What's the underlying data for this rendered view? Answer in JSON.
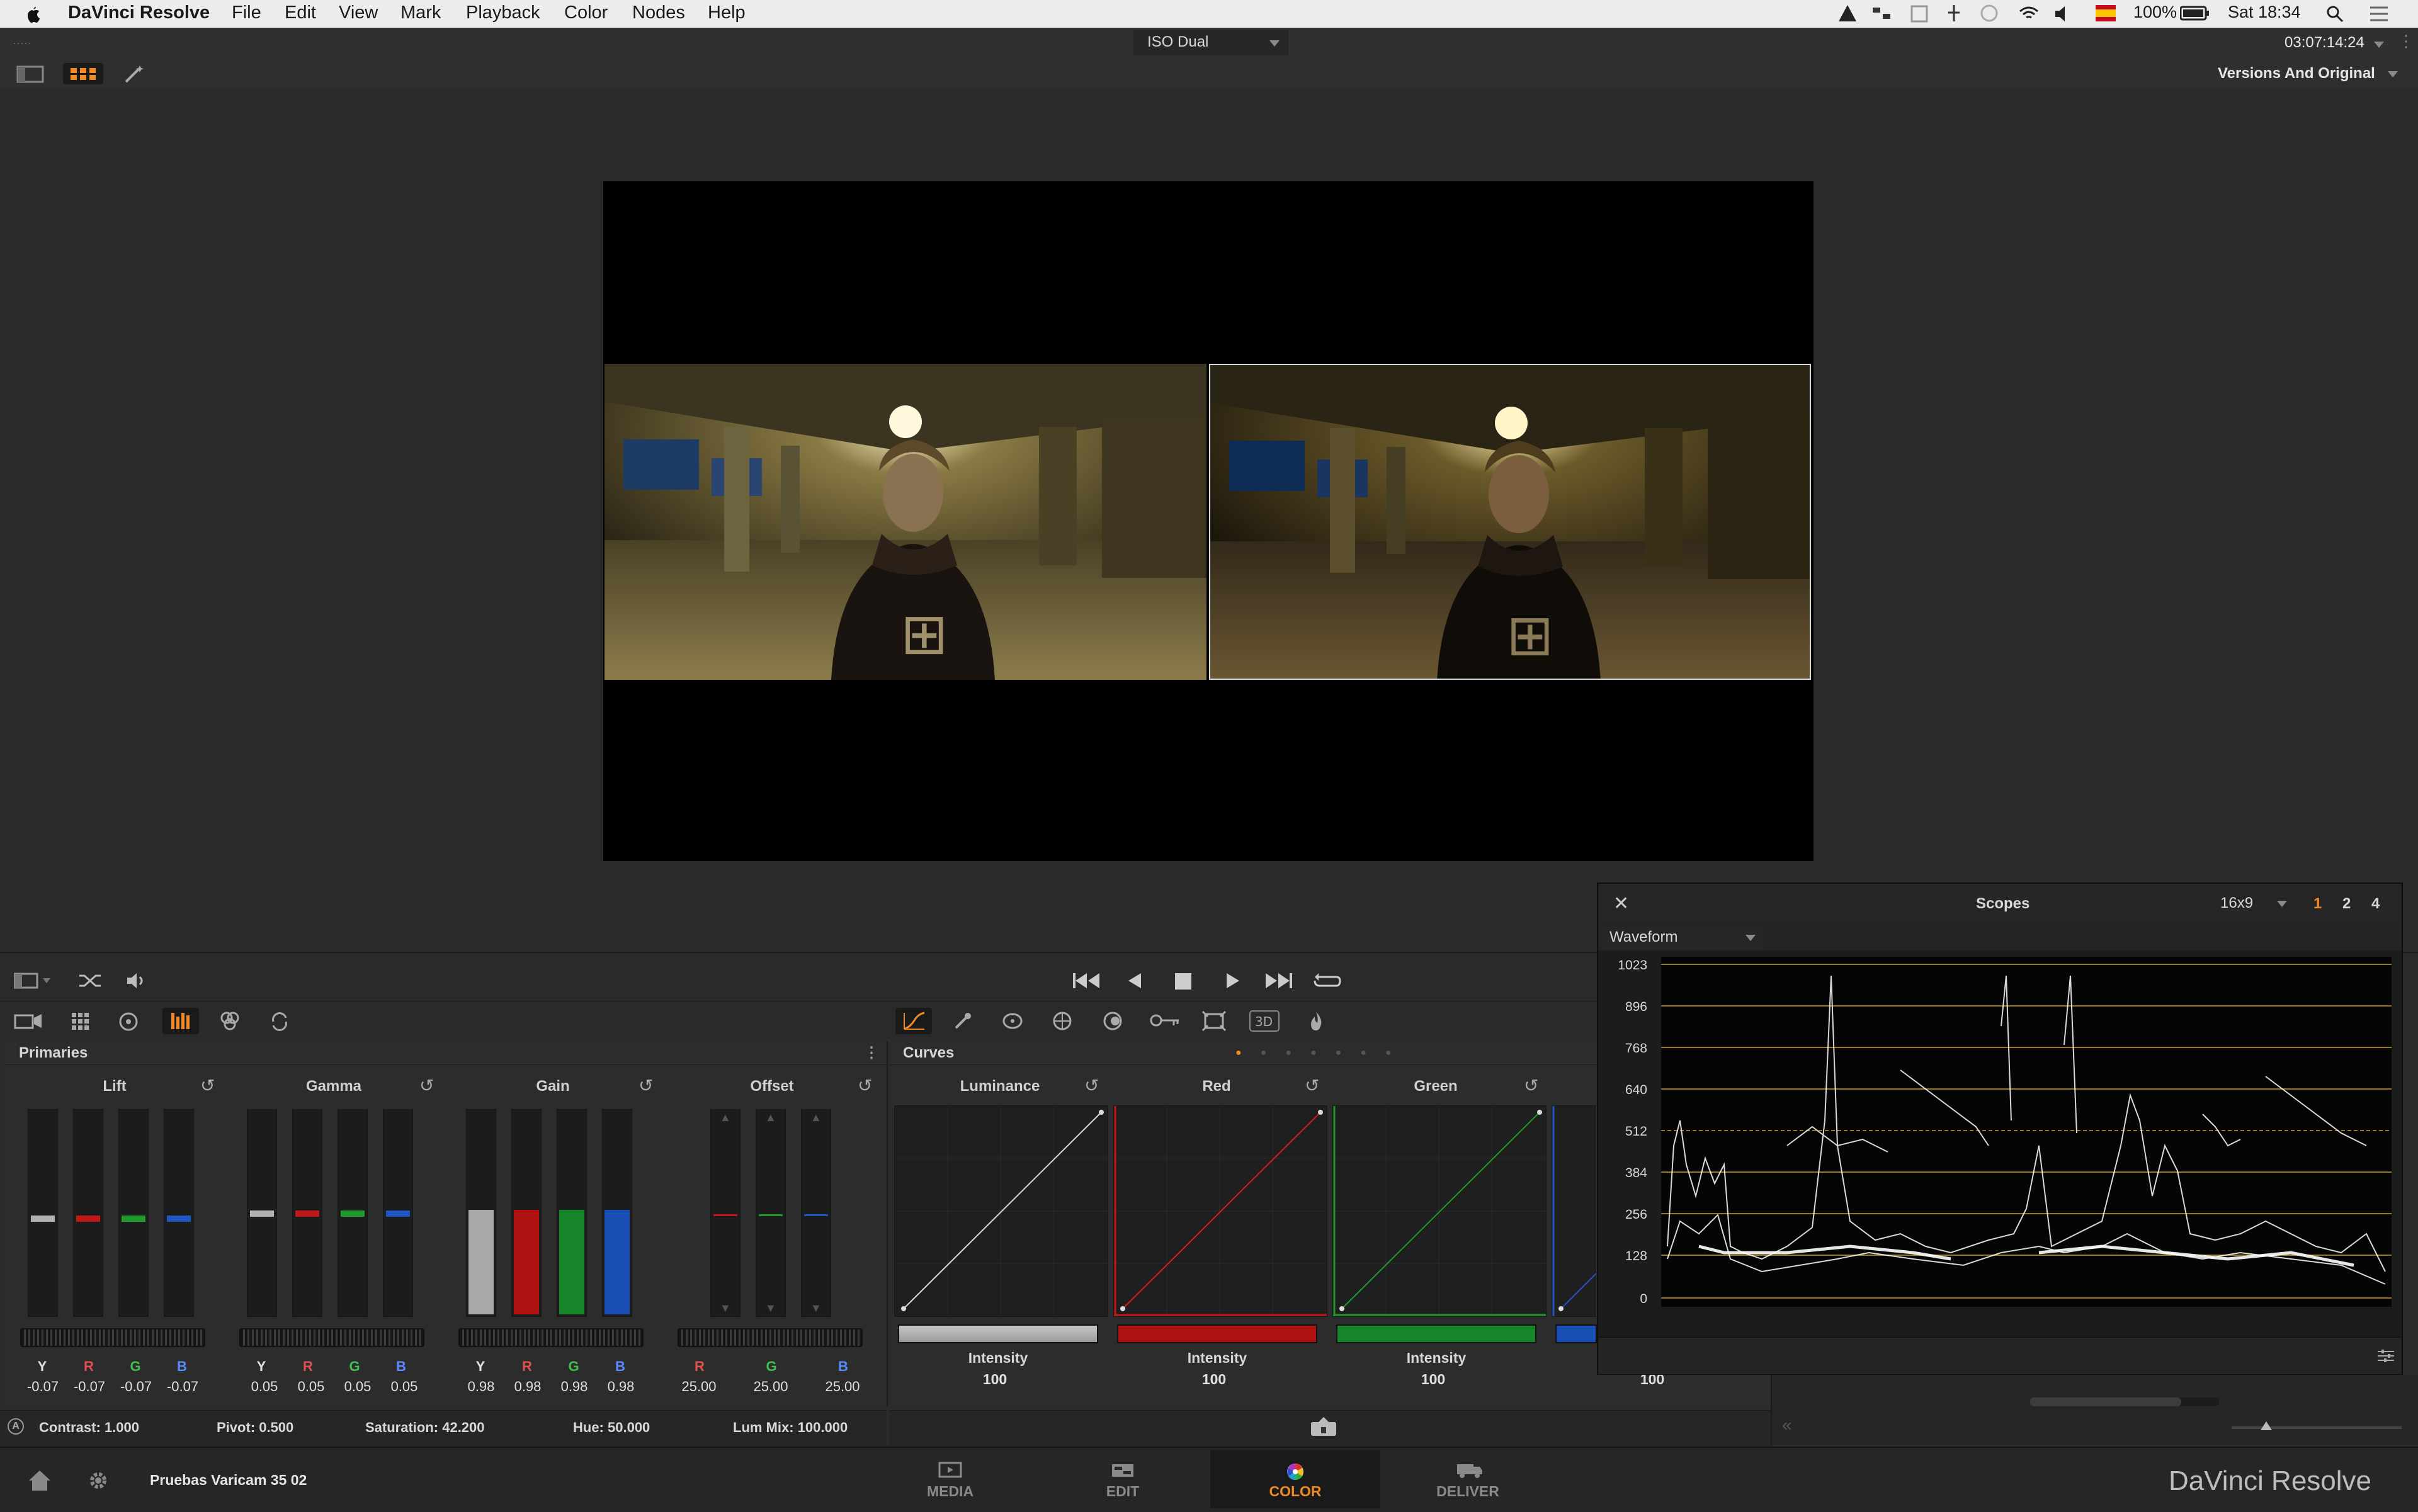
{
  "menubar": {
    "app_name": "DaVinci Resolve",
    "items": [
      "File",
      "Edit",
      "View",
      "Mark",
      "Playback",
      "Color",
      "Nodes",
      "Help"
    ],
    "status": {
      "battery": "100%",
      "clock": "Sat 18:34"
    }
  },
  "titlebar": {
    "view_mode": "ISO Dual",
    "timecode": "03:07:14:24"
  },
  "toolbar": {
    "versions_dropdown": "Versions And Original"
  },
  "primaries": {
    "title": "Primaries",
    "lift": {
      "title": "Lift",
      "channels": [
        "Y",
        "R",
        "G",
        "B"
      ],
      "values": [
        "-0.07",
        "-0.07",
        "-0.07",
        "-0.07"
      ]
    },
    "gamma": {
      "title": "Gamma",
      "channels": [
        "Y",
        "R",
        "G",
        "B"
      ],
      "values": [
        "0.05",
        "0.05",
        "0.05",
        "0.05"
      ]
    },
    "gain": {
      "title": "Gain",
      "channels": [
        "Y",
        "R",
        "G",
        "B"
      ],
      "values": [
        "0.98",
        "0.98",
        "0.98",
        "0.98"
      ]
    },
    "offset": {
      "title": "Offset",
      "channels": [
        "R",
        "G",
        "B"
      ],
      "values": [
        "25.00",
        "25.00",
        "25.00"
      ]
    },
    "footer": {
      "contrast": "Contrast: 1.000",
      "pivot": "Pivot: 0.500",
      "saturation": "Saturation: 42.200",
      "hue": "Hue: 50.000",
      "lummix": "Lum Mix: 100.000"
    }
  },
  "curves": {
    "title": "Curves",
    "luminance": {
      "title": "Luminance",
      "label": "Intensity",
      "value": "100"
    },
    "red": {
      "title": "Red",
      "label": "Intensity",
      "value": "100"
    },
    "green": {
      "title": "Green",
      "label": "Intensity",
      "value": "100"
    },
    "blue": {
      "value": "100"
    }
  },
  "scopes": {
    "title": "Scopes",
    "aspect": "16x9",
    "pages": [
      "1",
      "2",
      "4"
    ],
    "mode": "Waveform",
    "y_ticks": [
      "1023",
      "896",
      "768",
      "640",
      "512",
      "384",
      "256",
      "128",
      "0"
    ]
  },
  "bottom": {
    "project_name": "Pruebas Varicam 35 02",
    "pages": [
      "MEDIA",
      "EDIT",
      "COLOR",
      "DELIVER"
    ],
    "brand": "DaVinci Resolve"
  },
  "colors": {
    "accent": "#f08a24",
    "red": "#c01818",
    "green": "#1d9a2a",
    "blue": "#1e56c4"
  }
}
